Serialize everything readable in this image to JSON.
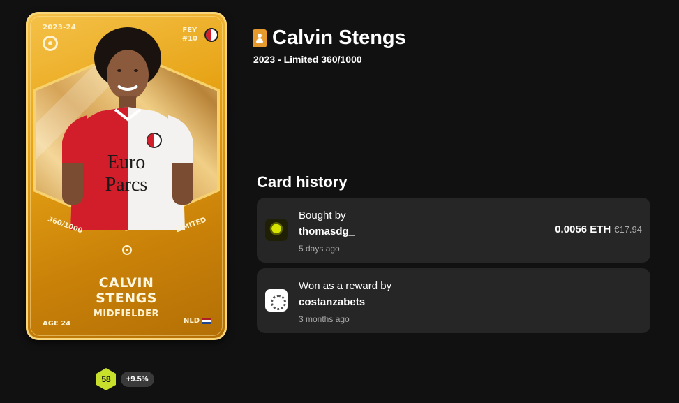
{
  "card": {
    "season": "2023-24",
    "club_code": "FEY",
    "shirt_number": "#10",
    "serial": "360/1000",
    "rarity": "LIMITED",
    "first_name": "CALVIN",
    "last_name": "STENGS",
    "position": "MIDFIELDER",
    "age": "AGE 24",
    "nationality": "NLD",
    "sponsor_line1": "Euro",
    "sponsor_line2": "Parcs"
  },
  "scores": {
    "score": "58",
    "trend": "+9.5%",
    "score_color": "#c8e02b"
  },
  "header": {
    "title": "Calvin Stengs",
    "subtitle": "2023 - Limited 360/1000",
    "icon": "player-card-icon"
  },
  "history": {
    "heading": "Card history",
    "items": [
      {
        "label": "Bought by",
        "user": "thomasdg_",
        "time": "5 days ago",
        "price_eth": "0.0056 ETH",
        "price_eur": "€17.94"
      },
      {
        "label": "Won as a reward by",
        "user": "costanzabets",
        "time": "3 months ago"
      }
    ]
  },
  "colors": {
    "background": "#111111",
    "panel": "#262626",
    "card_gold": "#e7a315"
  }
}
